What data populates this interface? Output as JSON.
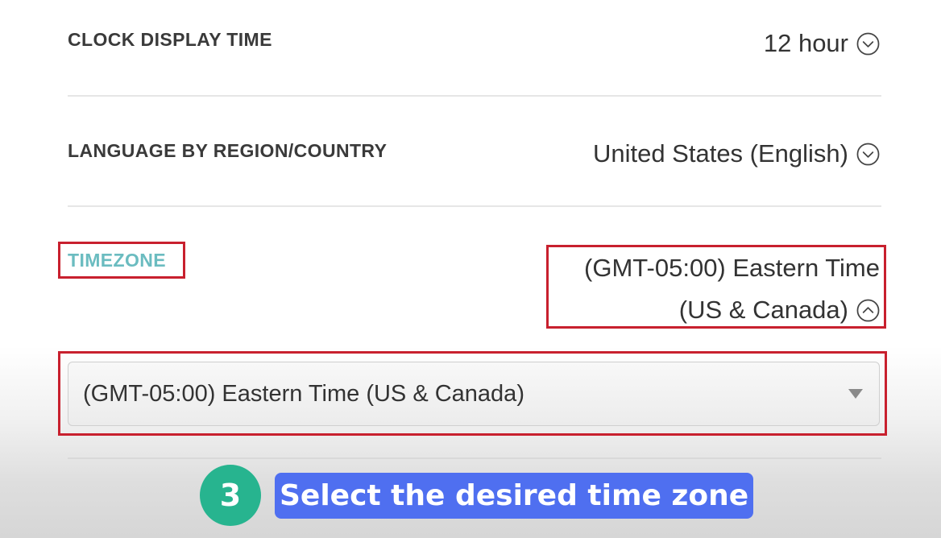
{
  "settings": {
    "clock": {
      "label": "CLOCK DISPLAY TIME",
      "value": "12 hour",
      "icon": "chevron-down-circle-icon"
    },
    "language": {
      "label": "LANGUAGE BY REGION/COUNTRY",
      "value": "United States (English)",
      "icon": "chevron-down-circle-icon"
    },
    "timezone": {
      "label": "TIMEZONE",
      "value_line1": "(GMT-05:00) Eastern Time",
      "value_line2": "(US & Canada)",
      "icon": "chevron-up-circle-icon",
      "select_value": "(GMT-05:00) Eastern Time (US & Canada)"
    }
  },
  "tutorial": {
    "step_number": "3",
    "caption": "Select the desired time zone"
  },
  "colors": {
    "timezone_label": "#6bbcc0",
    "highlight_border": "#c8202e",
    "step_circle": "#27b48f",
    "caption_background": "#4f6ff0"
  }
}
